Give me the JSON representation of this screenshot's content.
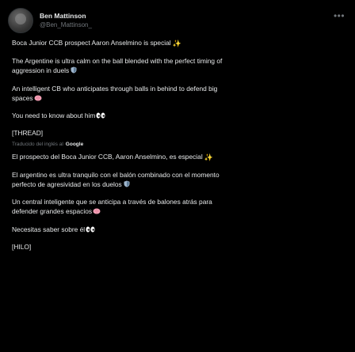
{
  "author": {
    "display_name": "Ben Mattinson",
    "handle": "@Ben_Mattinson_"
  },
  "icons": {
    "more": "more-icon",
    "avatar": "avatar",
    "sparkles": "sparkles-icon",
    "shield": "shield-icon",
    "brain": "brain-icon",
    "eyes": "eyes-icon"
  },
  "colors": {
    "background": "#000000",
    "text": "#e7e9ea",
    "secondary": "#71767b"
  },
  "original": {
    "line1": "Boca Junior CCB prospect Aaron Anselmino is special",
    "line2a": "The Argentine is ultra calm on the ball blended with the perfect timing of",
    "line2b": "aggression in duels",
    "line3a": "An intelligent CB who anticipates through balls in behind to defend big",
    "line3b": "spaces",
    "line4": "You need to know about him",
    "line5": "[THREAD]"
  },
  "translation": {
    "label": "Traducido del inglés al",
    "provider": "Google",
    "line1": "El prospecto del Boca Junior CCB, Aaron Anselmino, es especial",
    "line2a": "El argentino es ultra tranquilo con el balón combinado con el momento",
    "line2b": "perfecto de agresividad en los duelos",
    "line3a": "Un central inteligente que se anticipa a través de balones atrás para",
    "line3b": "defender grandes espacios",
    "line4": "Necesitas saber sobre él",
    "line5": "[HILO]"
  }
}
